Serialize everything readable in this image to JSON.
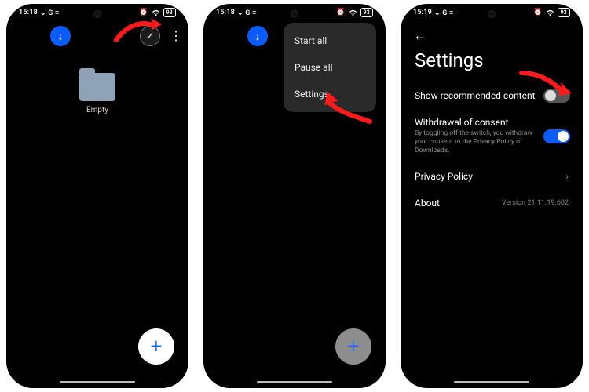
{
  "status": {
    "time1": "15:18",
    "time2": "15:18",
    "time3": "15:19",
    "left_icons": "⌄ G ≡",
    "battery": "93"
  },
  "screen1": {
    "download_glyph": "↓",
    "check_glyph": "✓",
    "more_glyph": "⋮",
    "folder_label": "Empty",
    "fab_glyph": "+"
  },
  "screen2": {
    "download_glyph": "↓",
    "menu": {
      "start": "Start all",
      "pause": "Pause all",
      "settings": "Settings"
    },
    "fab_glyph": "+"
  },
  "screen3": {
    "back_glyph": "←",
    "title": "Settings",
    "rec": {
      "label": "Show recommended content"
    },
    "withdraw": {
      "label": "Withdrawal of consent",
      "sub": "By toggling off the switch, you withdraw your consent to the Privacy Policy of Downloads."
    },
    "privacy": {
      "label": "Privacy Policy",
      "chev": "›"
    },
    "about": {
      "label": "About",
      "version": "Version 21.11.19.602"
    }
  }
}
